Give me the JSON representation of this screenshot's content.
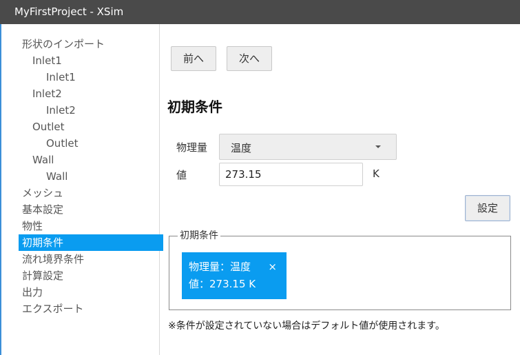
{
  "window": {
    "title": "MyFirstProject - XSim"
  },
  "sidebar": {
    "items": [
      {
        "label": "形状のインポート",
        "level": 0
      },
      {
        "label": "Inlet1",
        "level": 1
      },
      {
        "label": "Inlet1",
        "level": 2
      },
      {
        "label": "Inlet2",
        "level": 1
      },
      {
        "label": "Inlet2",
        "level": 2
      },
      {
        "label": "Outlet",
        "level": 1
      },
      {
        "label": "Outlet",
        "level": 2
      },
      {
        "label": "Wall",
        "level": 1
      },
      {
        "label": "Wall",
        "level": 2
      },
      {
        "label": "メッシュ",
        "level": 0
      },
      {
        "label": "基本設定",
        "level": 0
      },
      {
        "label": "物性",
        "level": 0
      },
      {
        "label": "初期条件",
        "level": 0,
        "selected": true
      },
      {
        "label": "流れ境界条件",
        "level": 0
      },
      {
        "label": "計算設定",
        "level": 0
      },
      {
        "label": "出力",
        "level": 0
      },
      {
        "label": "エクスポート",
        "level": 0
      }
    ]
  },
  "nav": {
    "prev_label": "前へ",
    "next_label": "次へ"
  },
  "section": {
    "title": "初期条件"
  },
  "form": {
    "quantity_label": "物理量",
    "quantity_value": "温度",
    "value_label": "値",
    "value": "273.15",
    "unit": "K",
    "set_label": "設定"
  },
  "conditions": {
    "legend": "初期条件",
    "chip": {
      "line1": "物理量：温度",
      "line2": "値：273.15 K",
      "close_glyph": "×"
    }
  },
  "note": "※条件が設定されていない場合はデフォルト値が使用されます。",
  "colors": {
    "titlebar": "#4a4a4a",
    "accent": "#0a9cf0",
    "sidebar_border": "#3c8fd8"
  }
}
